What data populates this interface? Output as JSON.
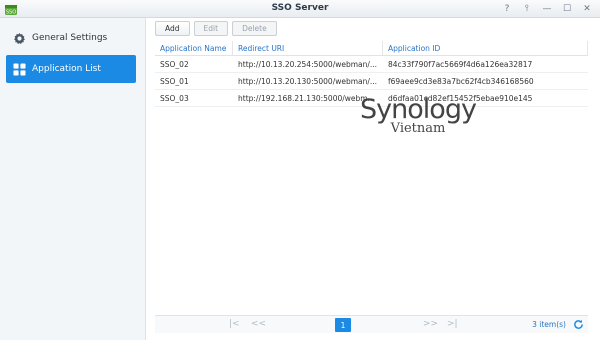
{
  "window": {
    "title": "SSO Server",
    "controls": [
      {
        "name": "help",
        "glyph": "?"
      },
      {
        "name": "pin",
        "glyph": "⫯"
      },
      {
        "name": "minimize",
        "glyph": "—"
      },
      {
        "name": "maximize",
        "glyph": "☐"
      },
      {
        "name": "close",
        "glyph": "✕"
      }
    ]
  },
  "sidebar": {
    "items": [
      {
        "label": "General Settings",
        "icon": "gear-icon",
        "active": false
      },
      {
        "label": "Application List",
        "icon": "grid-icon",
        "active": true
      }
    ]
  },
  "toolbar": {
    "add_label": "Add",
    "edit_label": "Edit",
    "delete_label": "Delete"
  },
  "table": {
    "columns": [
      "Application Name",
      "Redirect URI",
      "Application ID"
    ],
    "rows": [
      [
        "SSO_02",
        "http://10.13.20.254:5000/webman/...",
        "84c33f790f7ac5669f4d6a126ea32817"
      ],
      [
        "SSO_01",
        "http://10.13.20.130:5000/webman/...",
        "f69aee9cd3e83a7bc62f4cb346168560"
      ],
      [
        "SSO_03",
        "http://192.168.21.130:5000/webm...",
        "d6dfaa01cd82ef15452f5ebae910e145"
      ]
    ]
  },
  "watermark": {
    "brand": "Synology",
    "sub": "Vietnam"
  },
  "pager": {
    "first": "|<",
    "prev": "<<",
    "page": "1",
    "next": ">>",
    "last": ">|",
    "count": "3 item(s)"
  },
  "colors": {
    "accent": "#1a8ae5",
    "header_text": "#2a74c9"
  }
}
